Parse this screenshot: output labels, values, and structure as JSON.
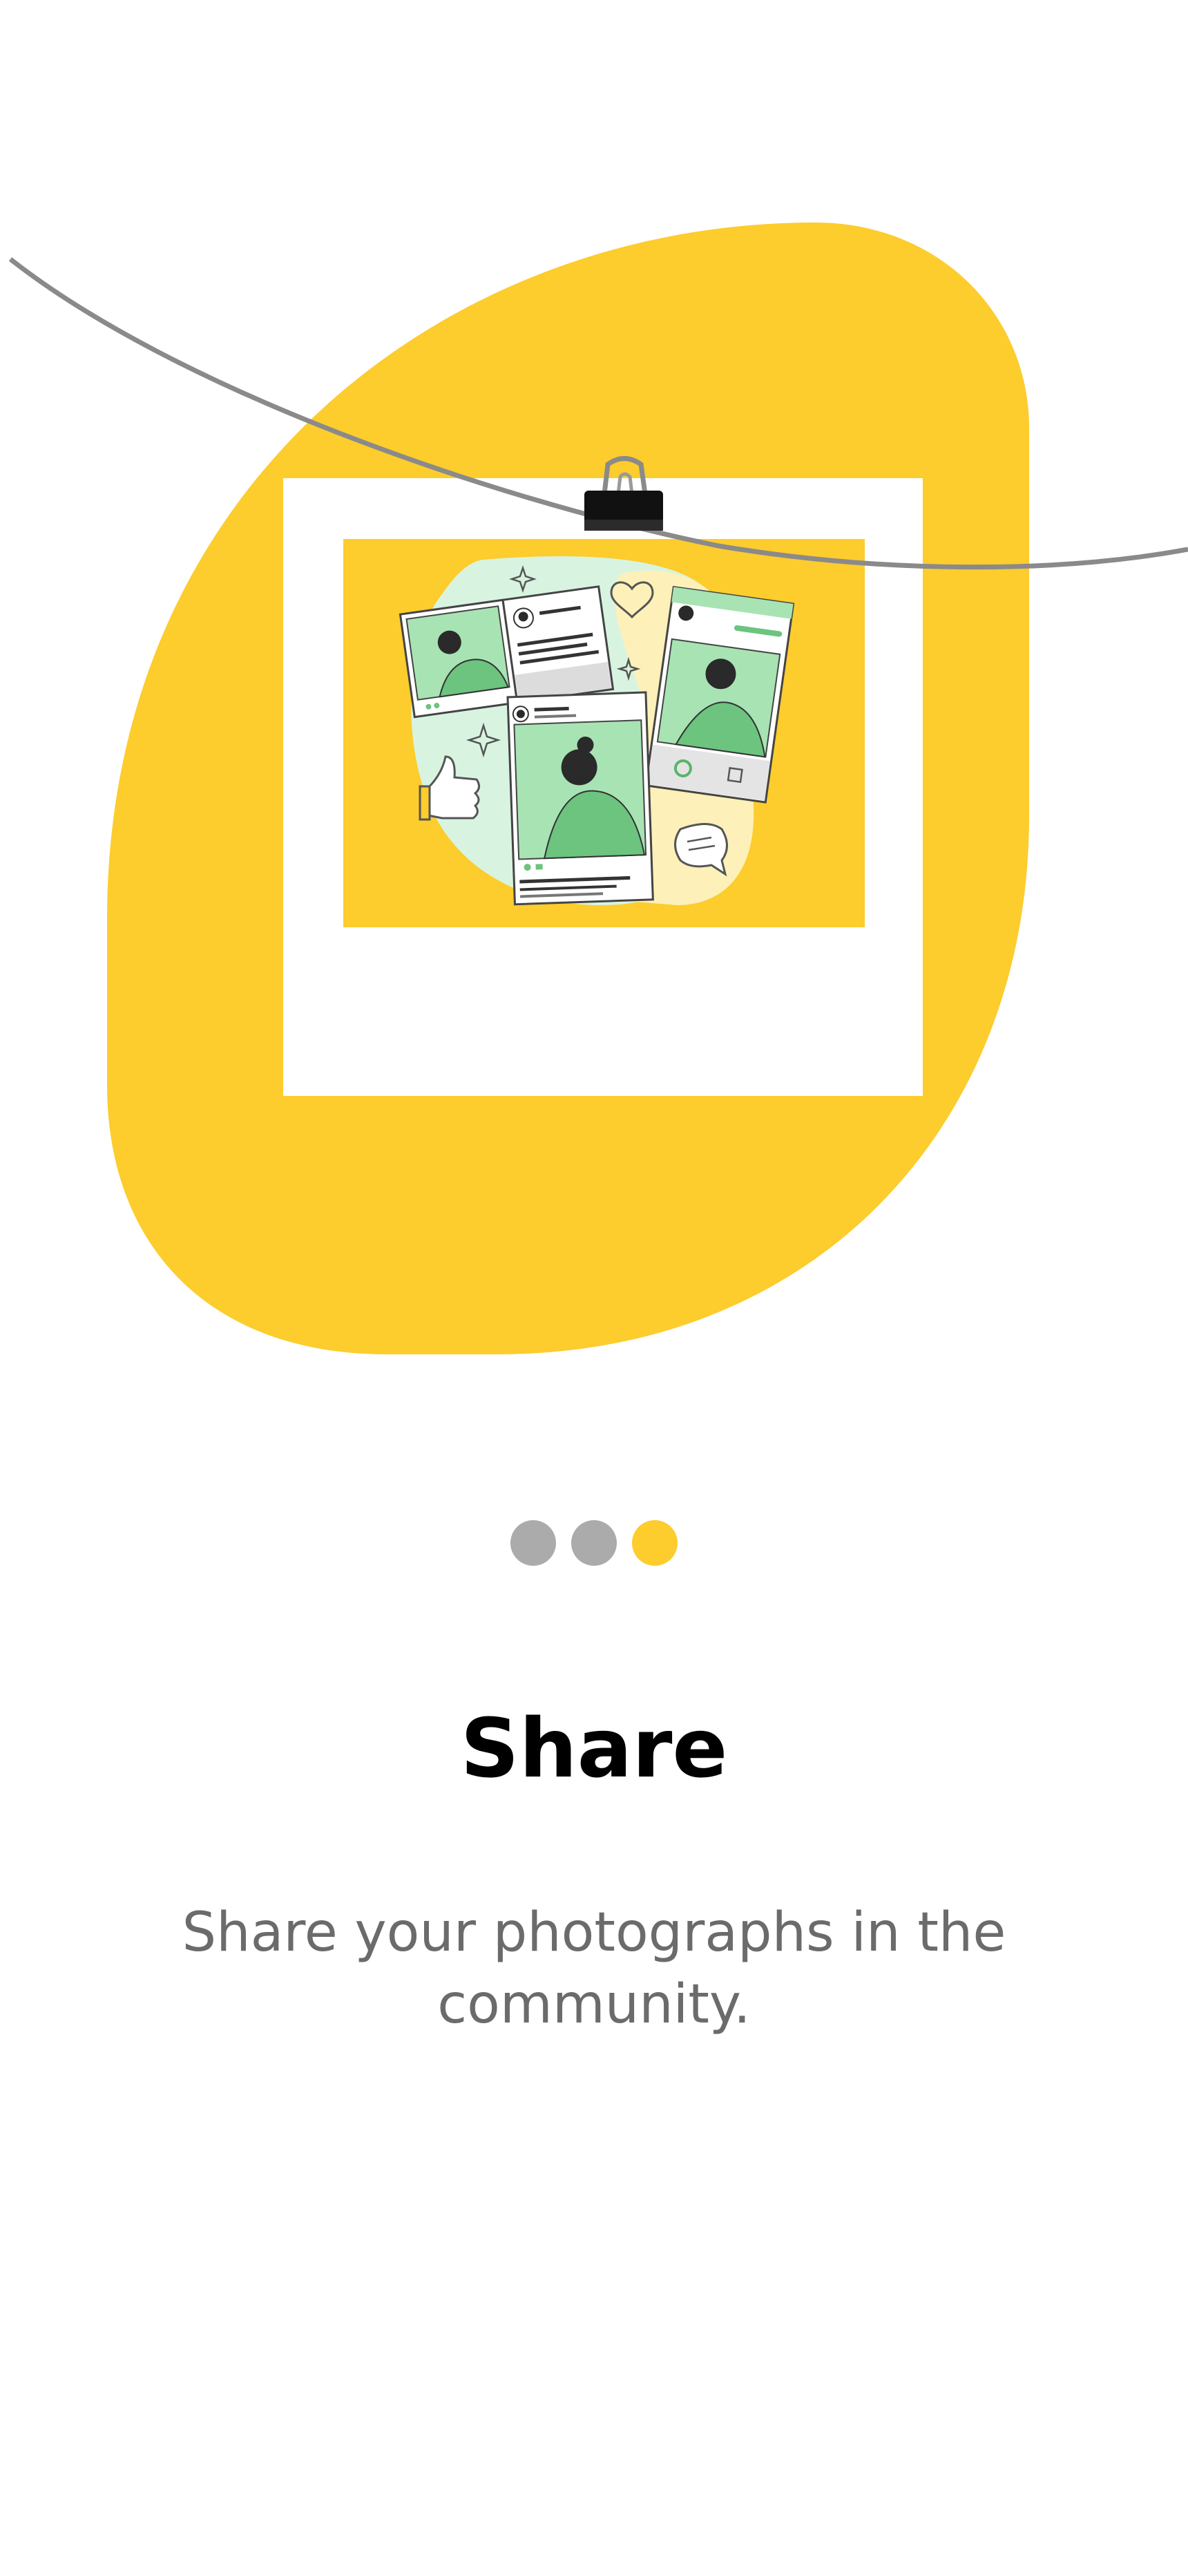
{
  "onboarding": {
    "title": "Share",
    "description": "Share your photographs in the community.",
    "pager": {
      "total": 3,
      "current": 3
    }
  },
  "colors": {
    "accent": "#fdcc2d",
    "dot_inactive": "#ababab",
    "title": "#000000",
    "description": "#6b6b6b",
    "illustration_green": "#8fd49a",
    "illustration_mint": "#d8f4e1"
  },
  "illustration": {
    "icons": [
      "clothesline-icon",
      "binder-clip-icon",
      "photo-frame-icon",
      "social-feed-illustration",
      "heart-icon",
      "thumbs-up-icon",
      "chat-bubble-icon",
      "sparkle-icon"
    ]
  }
}
